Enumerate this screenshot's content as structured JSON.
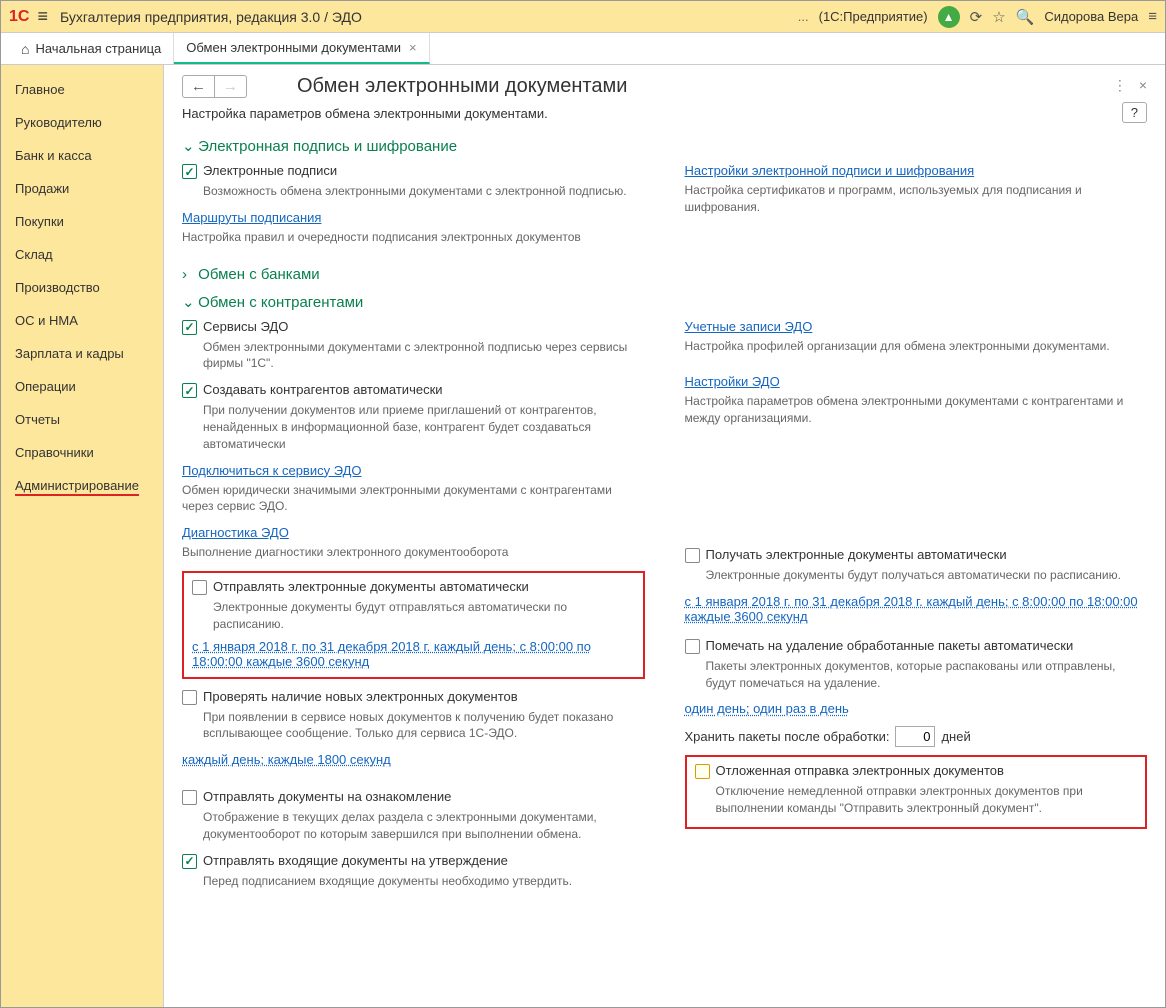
{
  "topbar": {
    "logo": "1C",
    "title": "Бухгалтерия предприятия, редакция 3.0 / ЭДО",
    "dots": "...",
    "product": "(1С:Предприятие)",
    "user": "Сидорова Вера"
  },
  "tabs": {
    "home": "Начальная страница",
    "active": "Обмен электронными документами"
  },
  "sidebar": {
    "items": [
      "Главное",
      "Руководителю",
      "Банк и касса",
      "Продажи",
      "Покупки",
      "Склад",
      "Производство",
      "ОС и НМА",
      "Зарплата и кадры",
      "Операции",
      "Отчеты",
      "Справочники",
      "Администрирование"
    ]
  },
  "main": {
    "title": "Обмен электронными документами",
    "subtitle": "Настройка параметров обмена электронными документами.",
    "help": "?",
    "sec1": {
      "title": "Электронная подпись и шифрование",
      "l": {
        "chk1": "Электронные подписи",
        "chk1d": "Возможность обмена электронными документами с электронной подписью.",
        "lnk1": "Маршруты подписания",
        "lnk1d": "Настройка правил и очередности подписания электронных документов"
      },
      "r": {
        "lnk1": "Настройки электронной подписи и шифрования",
        "lnk1d": "Настройка сертификатов и программ, используемых для подписания и шифрования."
      }
    },
    "sec2": {
      "title": "Обмен с банками"
    },
    "sec3": {
      "title": "Обмен с контрагентами",
      "l": {
        "chk1": "Сервисы ЭДО",
        "chk1d": "Обмен электронными документами с электронной подписью через сервисы фирмы \"1С\".",
        "chk2": "Создавать контрагентов автоматически",
        "chk2d": "При получении документов или приеме приглашений от контрагентов, ненайденных в информационной базе, контрагент будет создаваться автоматически",
        "lnk1": "Подключиться к сервису ЭДО",
        "lnk1d": "Обмен юридически значимыми электронными документами с контрагентами через сервис ЭДО.",
        "lnk2": "Диагностика ЭДО",
        "lnk2d": "Выполнение диагностики электронного документооборота",
        "chk3": "Отправлять электронные документы автоматически",
        "chk3d": "Электронные документы будут отправляться автоматически по расписанию.",
        "sched1": "с 1 января 2018 г. по 31 декабря 2018 г. каждый день; с 8:00:00 по 18:00:00 каждые 3600 секунд",
        "chk4": "Проверять наличие новых электронных документов",
        "chk4d": "При появлении в сервисе новых документов к получению будет показано всплывающее сообщение. Только для сервиса 1С-ЭДО.",
        "sched2": "каждый день; каждые 1800 секунд",
        "chk5": "Отправлять документы на ознакомление",
        "chk5d": "Отображение в текущих делах  раздела с электронными документами, документооборот по которым завершился при выполнении обмена.",
        "chk6": "Отправлять входящие документы на утверждение",
        "chk6d": "Перед подписанием входящие документы необходимо утвердить."
      },
      "r": {
        "lnk1": "Учетные записи ЭДО",
        "lnk1d": "Настройка профилей организации для обмена электронными документами.",
        "lnk2": "Настройки ЭДО",
        "lnk2d": "Настройка параметров обмена электронными документами с контрагентами и между организациями.",
        "chk1": "Получать электронные документы автоматически",
        "chk1d": "Электронные документы будут получаться автоматически по расписанию.",
        "sched1": "с 1 января 2018 г. по 31 декабря 2018 г. каждый день; с 8:00:00 по 18:00:00 каждые 3600 секунд",
        "chk2": "Помечать на удаление обработанные пакеты автоматически",
        "chk2d": "Пакеты электронных документов, которые распакованы или отправлены, будут помечаться на удаление.",
        "sched2": "один день; один раз в день",
        "storage_lbl": "Хранить пакеты после обработки:",
        "storage_val": "0",
        "storage_unit": "дней",
        "chk3": "Отложенная отправка электронных документов",
        "chk3d": "Отключение немедленной отправки электронных документов при выполнении команды \"Отправить электронный документ\"."
      }
    }
  }
}
